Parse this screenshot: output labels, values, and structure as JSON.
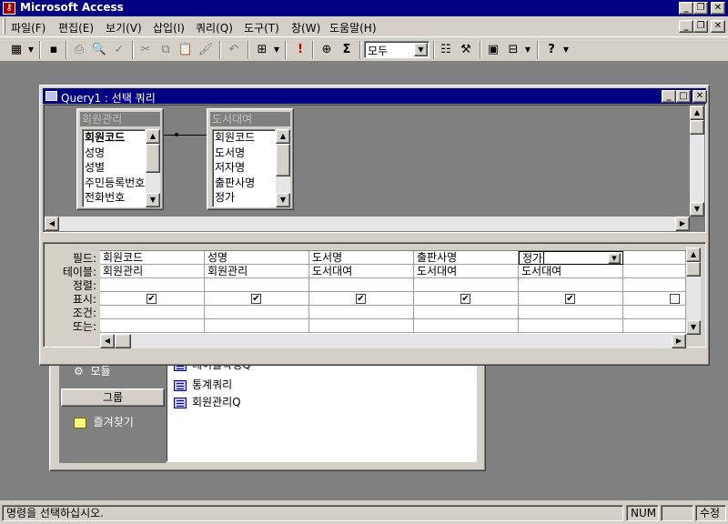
{
  "app": {
    "title": "Microsoft Access"
  },
  "menu": [
    "파일(F)",
    "편집(E)",
    "보기(V)",
    "삽입(I)",
    "쿼리(Q)",
    "도구(T)",
    "창(W)",
    "도움말(H)"
  ],
  "toolbar": {
    "combo_value": "모두",
    "sigma": "Σ"
  },
  "query_window": {
    "title": "Query1 : 선택 쿼리",
    "tables": [
      {
        "name": "회원관리",
        "fields": [
          "회원코드",
          "성명",
          "성별",
          "주민등록번호",
          "전화번호"
        ]
      },
      {
        "name": "도서대여",
        "fields": [
          "회원코드",
          "도서명",
          "저자명",
          "출판사명",
          "정가"
        ]
      }
    ],
    "row_labels": [
      "필드:",
      "테이블:",
      "정렬:",
      "표시:",
      "조건:",
      "또는:"
    ],
    "columns": [
      {
        "field": "회원코드",
        "table": "회원관리",
        "show": true
      },
      {
        "field": "성명",
        "table": "회원관리",
        "show": true
      },
      {
        "field": "도서명",
        "table": "도서대여",
        "show": true
      },
      {
        "field": "출판사명",
        "table": "도서대여",
        "show": true
      },
      {
        "field": "정가",
        "table": "도서대여",
        "show": true
      },
      {
        "field": "",
        "table": "",
        "show": false
      }
    ]
  },
  "db_window": {
    "objects": {
      "module": "모듈",
      "group": "그룹",
      "favorites": "즐겨찾기"
    },
    "list": [
      "테이블작성Q",
      "통계쿼리",
      "회원관리Q"
    ]
  },
  "status": {
    "message": "명령을 선택하십시오.",
    "num": "NUM",
    "mode": "수정"
  }
}
